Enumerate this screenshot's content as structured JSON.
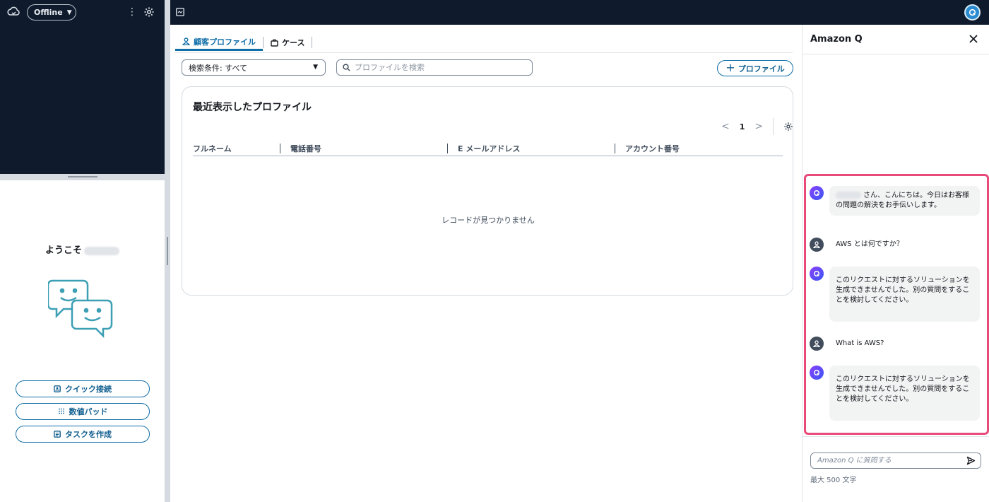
{
  "left_panel": {
    "status": "Offline",
    "welcome": "ようこそ",
    "buttons": {
      "quick_connect": "クイック接続",
      "numpad": "数値パッド",
      "create_task": "タスクを作成"
    }
  },
  "main": {
    "tabs": {
      "customer_profile": "顧客プロファイル",
      "cases": "ケース"
    },
    "filter_label": "検索条件: すべて",
    "search_placeholder": "プロファイルを検索",
    "add_profile_label": "プロファイル",
    "card_title": "最近表示したプロファイル",
    "pager": {
      "current_page": "1"
    },
    "columns": {
      "full_name": "フルネーム",
      "phone": "電話番号",
      "email": "E メールアドレス",
      "account": "アカウント番号"
    },
    "empty_message": "レコードが見つかりません"
  },
  "amazon_q": {
    "title": "Amazon Q",
    "messages": [
      {
        "role": "assistant",
        "text": "さん、こんにちは。今日はお客様の問題の解決をお手伝いします。"
      },
      {
        "role": "user",
        "text": "AWS とは何ですか？"
      },
      {
        "role": "assistant",
        "text": "このリクエストに対するソリューションを生成できませんでした。別の質問をすることを検討してください。"
      },
      {
        "role": "user",
        "text": "What is AWS?"
      },
      {
        "role": "assistant",
        "text": "このリクエストに対するソリューションを生成できませんでした。別の質問をすることを検討してください。"
      }
    ],
    "input_placeholder": "Amazon Q に質問する",
    "char_limit": "最大 500 文字"
  },
  "colors": {
    "dark_bg": "#0f1b2d",
    "accent": "#0f6ea8",
    "highlight": "#e84a7a",
    "q_gradient_start": "#8a3ffc"
  }
}
